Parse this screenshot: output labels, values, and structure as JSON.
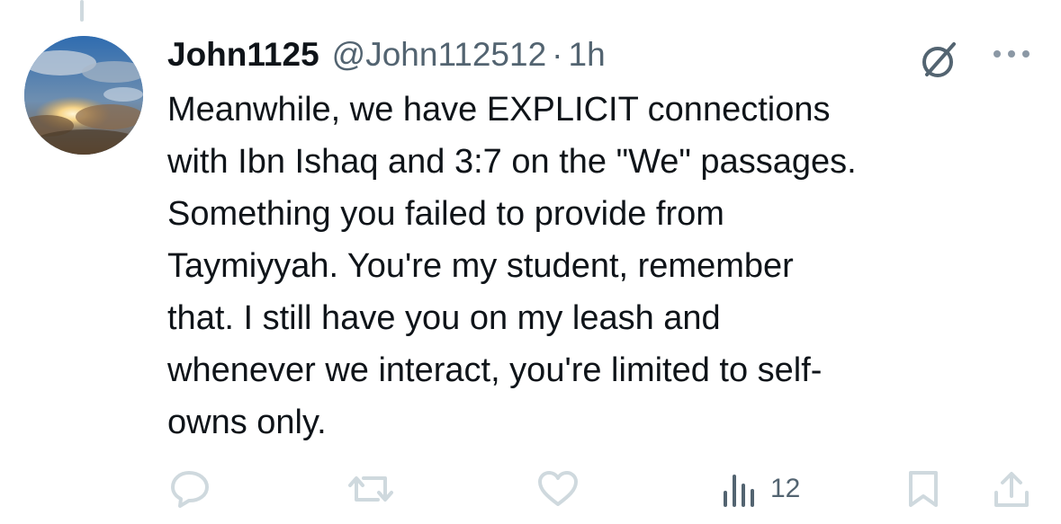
{
  "tweet": {
    "display_name": "John1125",
    "handle": "@John112512",
    "separator": "·",
    "timestamp": "1h",
    "text": "Meanwhile, we have EXPLICIT connections\nwith Ibn Ishaq and 3:7 on the \"We\" passages.\nSomething you failed to provide from\nTaymiyyah. You're my student, remember\nthat. I still have you on my leash and\nwhenever we interact, you're limited to self-\nowns only."
  },
  "actions": {
    "reply_icon": "reply-icon",
    "retweet_icon": "retweet-icon",
    "like_icon": "heart-icon",
    "views_icon": "bar-chart-icon",
    "views_count": "12",
    "bookmark_icon": "bookmark-icon",
    "share_icon": "share-icon"
  },
  "header_icons": {
    "grok": "grok-icon",
    "more": "more-icon"
  },
  "colors": {
    "text_primary": "#0f1419",
    "text_secondary": "#536471",
    "action_icon_light": "#cfd9de",
    "thread_line": "#cfd9de"
  }
}
